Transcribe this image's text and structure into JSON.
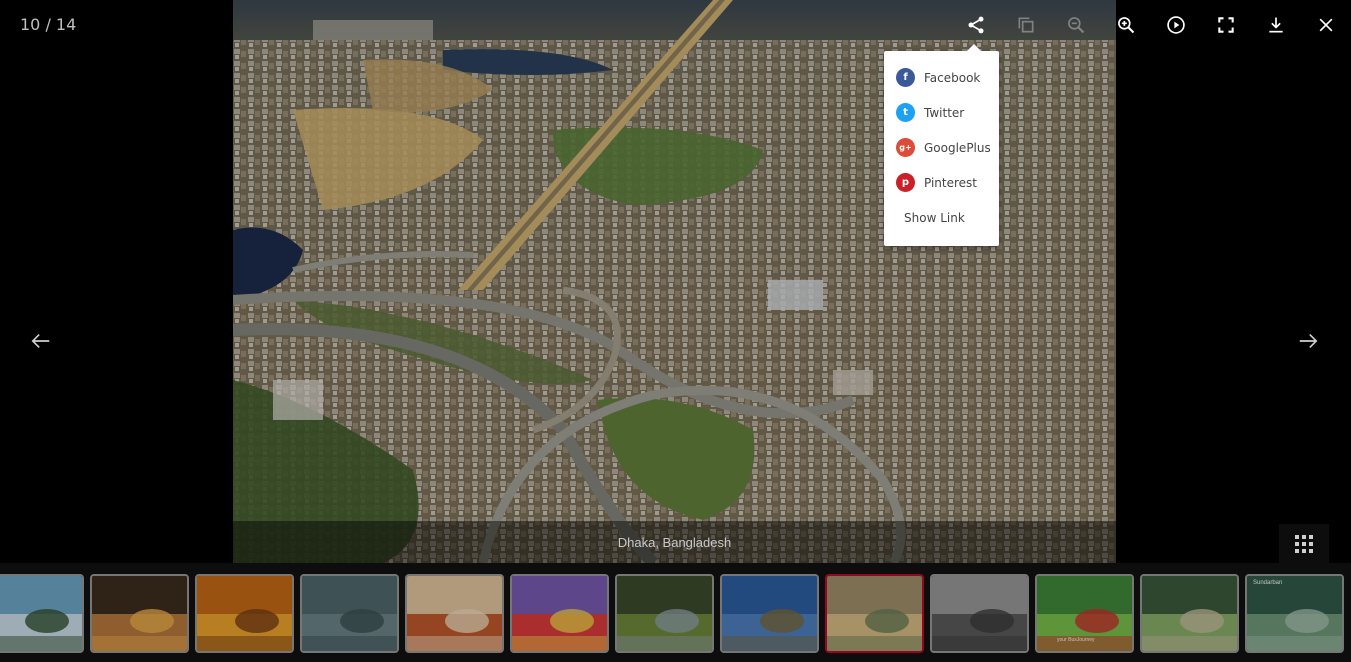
{
  "gallery": {
    "counter": "10 / 14",
    "caption": "Dhaka, Bangladesh"
  },
  "toolbar": [
    {
      "name": "share-icon",
      "dim": false
    },
    {
      "name": "copy-icon",
      "dim": true
    },
    {
      "name": "zoom-out-icon",
      "dim": true
    },
    {
      "name": "zoom-in-icon",
      "dim": false
    },
    {
      "name": "play-icon",
      "dim": false
    },
    {
      "name": "fullscreen-icon",
      "dim": false
    },
    {
      "name": "download-icon",
      "dim": false
    },
    {
      "name": "close-icon",
      "dim": false
    }
  ],
  "share_menu": {
    "items": [
      {
        "label": "Facebook",
        "icon": "facebook-icon",
        "glyph": "f",
        "color": "#3b5998"
      },
      {
        "label": "Twitter",
        "icon": "twitter-icon",
        "glyph": "t",
        "color": "#1da1f2"
      },
      {
        "label": "GooglePlus",
        "icon": "googleplus-icon",
        "glyph": "g+",
        "color": "#dd4b39"
      },
      {
        "label": "Pinterest",
        "icon": "pinterest-icon",
        "glyph": "p",
        "color": "#cb2027"
      }
    ],
    "show_link": "Show Link"
  },
  "thumbnails": [
    {
      "name": "thumb-tree-beach",
      "colors": [
        "#6fa8c9",
        "#cfe3ee",
        "#2f4f2f"
      ]
    },
    {
      "name": "thumb-sunset-sea",
      "colors": [
        "#3b2a1a",
        "#b9793a",
        "#f2b04a"
      ]
    },
    {
      "name": "thumb-orange-sunset",
      "colors": [
        "#c96a12",
        "#f0a52a",
        "#7a3b10"
      ]
    },
    {
      "name": "thumb-bird-lake",
      "colors": [
        "#4f6a6e",
        "#6b8488",
        "#3a4f52"
      ]
    },
    {
      "name": "thumb-food-plate",
      "colors": [
        "#e8c8a0",
        "#c4582a",
        "#f4e0c0"
      ]
    },
    {
      "name": "thumb-colorful-mask",
      "colors": [
        "#7a5ab4",
        "#e03a3a",
        "#f2d24a"
      ]
    },
    {
      "name": "thumb-green-valley",
      "colors": [
        "#3b4a2a",
        "#6f8a3a",
        "#8fa0a8"
      ]
    },
    {
      "name": "thumb-camels",
      "colors": [
        "#2a5fa6",
        "#4d7fc2",
        "#7a6a3a"
      ]
    },
    {
      "name": "thumb-city-aerial",
      "colors": [
        "#8a7a5a",
        "#b8a070",
        "#5a6a4a"
      ]
    },
    {
      "name": "thumb-umbrella-walk",
      "colors": [
        "#9a9a9a",
        "#5a5a5a",
        "#3a3a3a"
      ]
    },
    {
      "name": "thumb-red-bus-trees",
      "colors": [
        "#3f8a3a",
        "#7ac24a",
        "#d02a2a"
      ]
    },
    {
      "name": "thumb-forest-path",
      "colors": [
        "#3a5a3a",
        "#8ab06a",
        "#c8c0a0"
      ]
    },
    {
      "name": "thumb-sundarban",
      "colors": [
        "#2f5a4a",
        "#6f9a7a",
        "#a8c0b0"
      ]
    }
  ],
  "thumbnail_labels": {
    "sundarban": "Sundarban",
    "bus": "your BusJourney"
  },
  "active_thumbnail": 8
}
